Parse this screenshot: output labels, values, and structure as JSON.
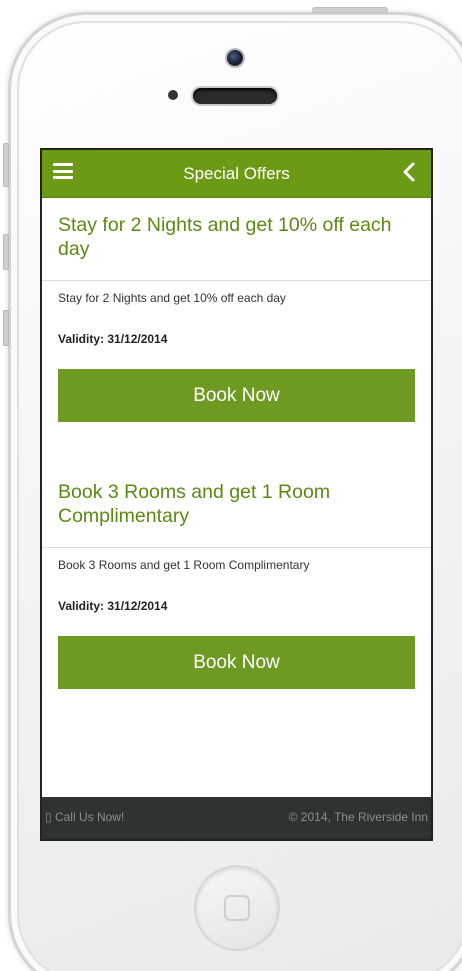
{
  "header": {
    "title": "Special Offers",
    "accent_color": "#6c9a14",
    "menu_icon": "hamburger-menu-icon",
    "back_icon": "chevron-left-icon"
  },
  "offers": [
    {
      "title": "Stay for 2 Nights and get 10% off each day",
      "description": "Stay for 2 Nights and get 10% off each day",
      "validity": "Validity: 31/12/2014",
      "button_label": "Book Now"
    },
    {
      "title": "Book 3 Rooms and get 1 Room Complimentary",
      "description": "Book 3 Rooms and get 1 Room Complimentary",
      "validity": "Validity: 31/12/2014",
      "button_label": "Book Now"
    }
  ],
  "footer": {
    "call_label": "▯ Call Us Now!",
    "copyright": "© 2014, The Riverside Inn",
    "background_color": "#2f3232"
  }
}
